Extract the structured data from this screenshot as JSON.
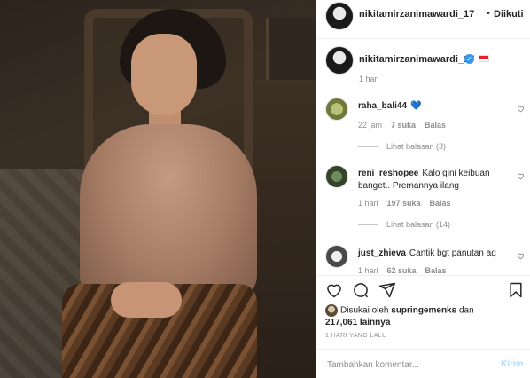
{
  "header": {
    "username": "nikitamirzanimawardi_17",
    "separator": "•",
    "follow_label": "Diikuti"
  },
  "caption": {
    "username": "nikitamirzanimawardi_17",
    "verified_symbol": "✓",
    "time": "1 hari"
  },
  "comments": [
    {
      "username": "raha_bali44",
      "text": "💙",
      "time": "22 jam",
      "likes": "7 suka",
      "reply": "Balas",
      "view_replies": "Lihat balasan (3)"
    },
    {
      "username": "reni_reshopee",
      "text": "Kalo gini keibuan banget.. Premannya ilang",
      "time": "1 hari",
      "likes": "197 suka",
      "reply": "Balas",
      "view_replies": "Lihat balasan (14)"
    },
    {
      "username": "just_zhieva",
      "text": "Cantik bgt panutan aq",
      "time": "1 hari",
      "likes": "62 suka",
      "reply": "Balas"
    }
  ],
  "likes": {
    "prefix": "Disukai oleh",
    "user": "supringemenks",
    "connector": "dan",
    "count": "217,061 lainnya"
  },
  "posted_ago": "1 HARI YANG LALU",
  "comment_input": {
    "placeholder": "Tambahkan komentar...",
    "send_label": "Kirim"
  },
  "icons": {
    "like": "heart-icon",
    "comment": "comment-icon",
    "share": "send-icon",
    "save": "bookmark-icon"
  },
  "colors": {
    "link_blue": "#3897f0",
    "send_disabled": "#b2dffc",
    "secondary_text": "#8e8e8e"
  }
}
